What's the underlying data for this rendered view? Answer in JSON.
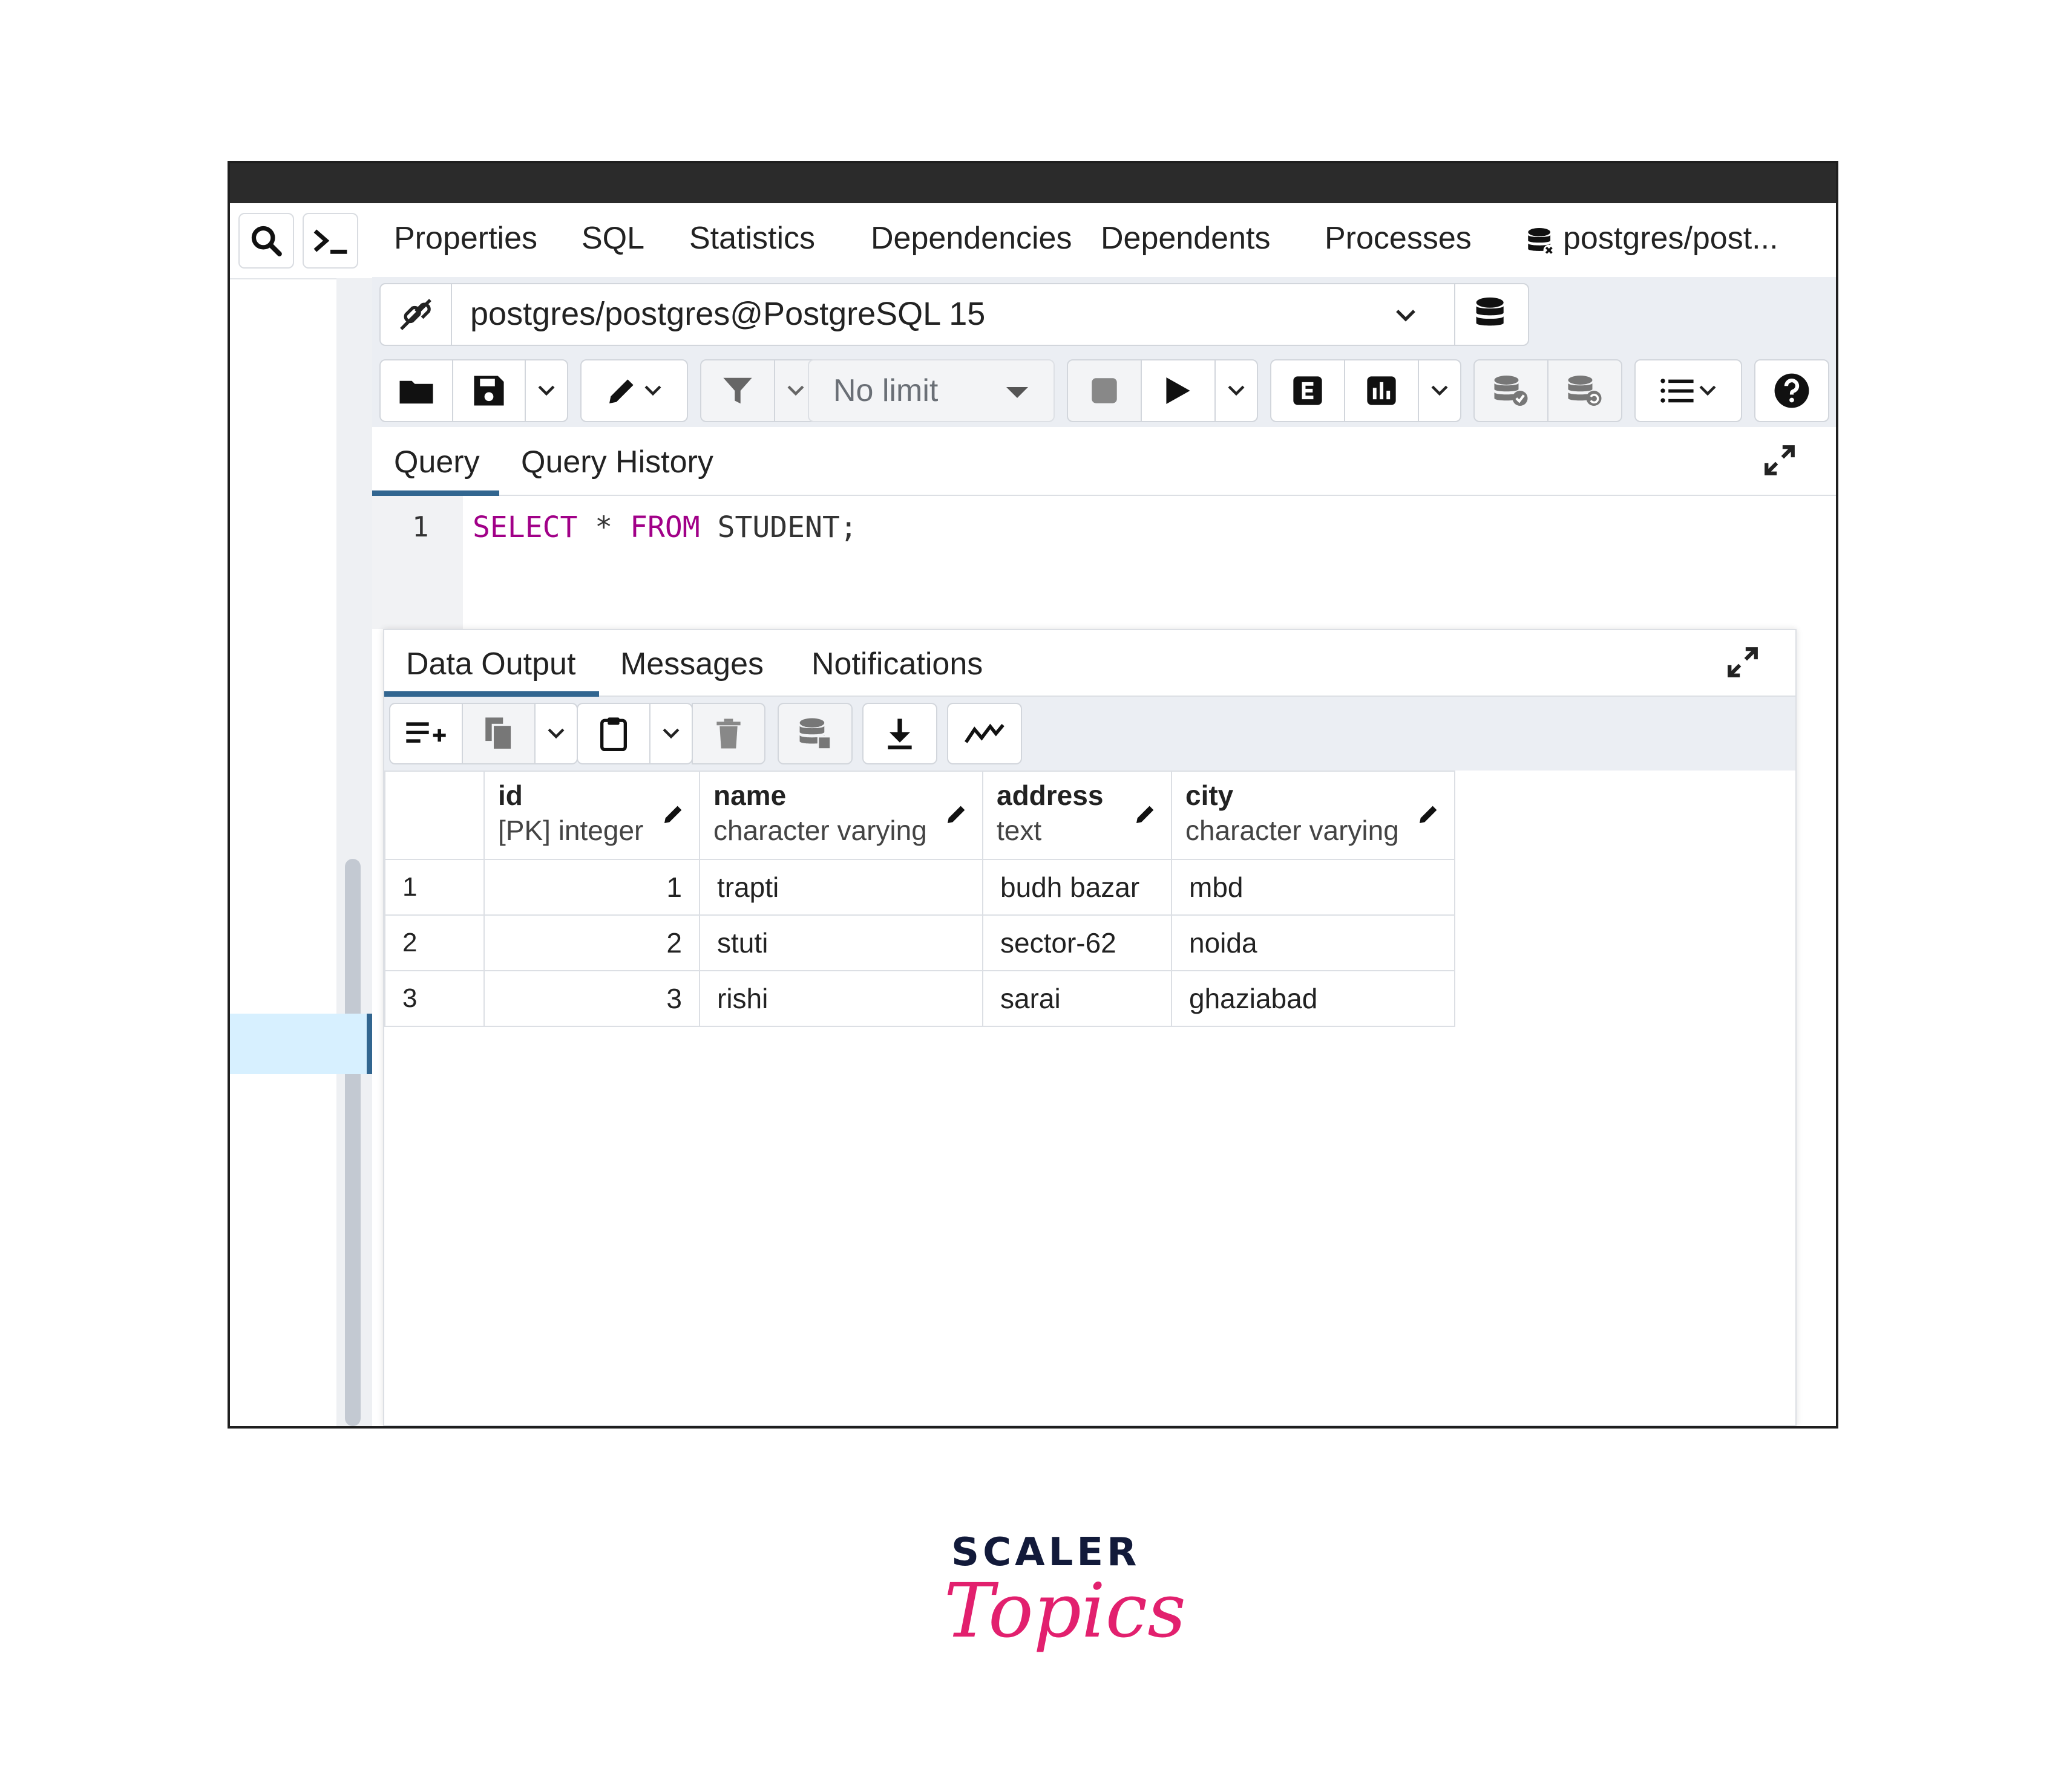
{
  "tabs": [
    "Properties",
    "SQL",
    "Statistics",
    "Dependencies",
    "Dependents",
    "Processes",
    "postgres/post..."
  ],
  "connection": {
    "label": "postgres/postgres@PostgreSQL 15"
  },
  "toolbar": {
    "limit_label": "No limit"
  },
  "query_tabs": [
    "Query",
    "Query History"
  ],
  "editor": {
    "line_number": "1",
    "tokens": {
      "select": "SELECT",
      "star": " * ",
      "from": "FROM",
      "rest": " STUDENT;"
    }
  },
  "output_tabs": [
    "Data Output",
    "Messages",
    "Notifications"
  ],
  "columns": [
    {
      "name": "id",
      "type": "[PK] integer"
    },
    {
      "name": "name",
      "type": "character varying"
    },
    {
      "name": "address",
      "type": "text"
    },
    {
      "name": "city",
      "type": "character varying"
    }
  ],
  "rows": [
    [
      "1",
      "1",
      "trapti",
      "budh bazar",
      "mbd"
    ],
    [
      "2",
      "2",
      "stuti",
      "sector-62",
      "noida"
    ],
    [
      "3",
      "3",
      "rishi",
      "sarai",
      "ghaziabad"
    ]
  ],
  "logo": {
    "top": "SCALER",
    "bottom": "Topics"
  },
  "colors": {
    "accent": "#326690",
    "keyword": "#a10088",
    "brand_pink": "#e2206e",
    "brand_navy": "#121a3a",
    "selection": "#d7f0ff"
  }
}
